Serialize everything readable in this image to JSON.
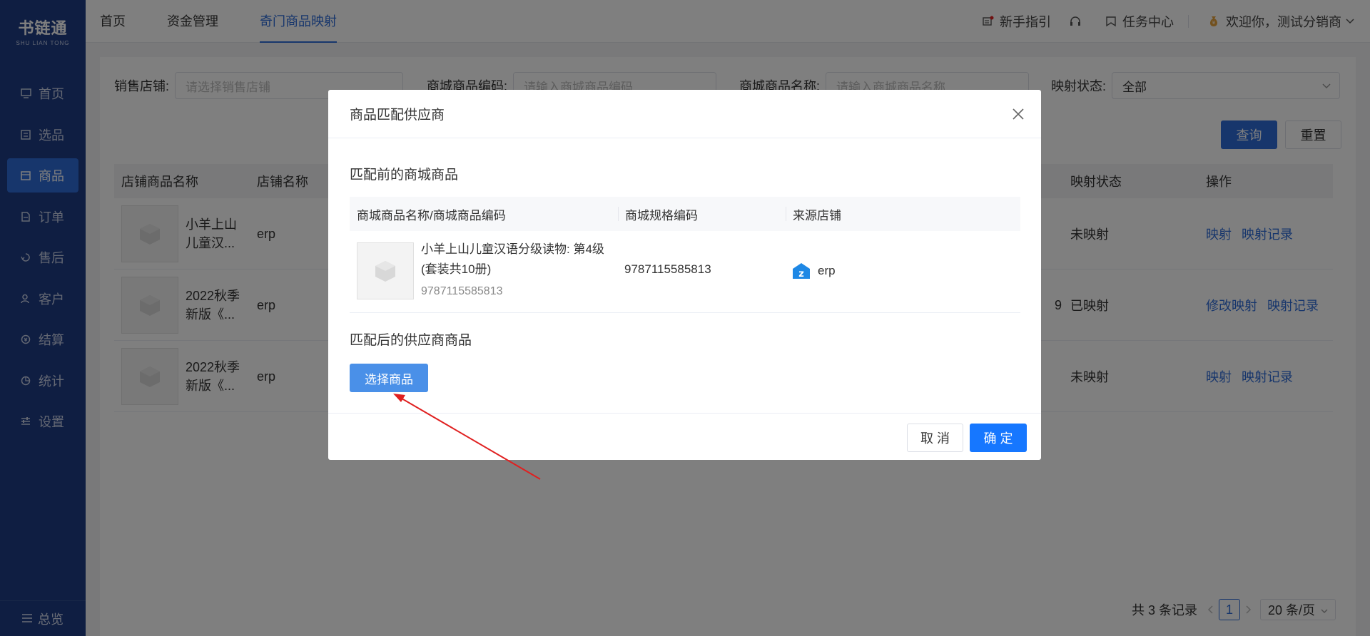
{
  "app": {
    "logo_cn": "书链通",
    "logo_en": "SHU LIAN TONG"
  },
  "sidebar": {
    "items": [
      {
        "label": "首页",
        "icon": "monitor-icon"
      },
      {
        "label": "选品",
        "icon": "select-icon"
      },
      {
        "label": "商品",
        "icon": "product-icon",
        "active": true
      },
      {
        "label": "订单",
        "icon": "order-icon"
      },
      {
        "label": "售后",
        "icon": "aftersale-icon"
      },
      {
        "label": "客户",
        "icon": "customer-icon"
      },
      {
        "label": "结算",
        "icon": "settlement-icon"
      },
      {
        "label": "统计",
        "icon": "chart-icon"
      },
      {
        "label": "设置",
        "icon": "settings-icon"
      }
    ],
    "bottom_label": "总览"
  },
  "topnav": {
    "tabs": [
      "首页",
      "资金管理",
      "奇门商品映射"
    ],
    "active_index": 2
  },
  "topright": {
    "guide": "新手指引",
    "tasks": "任务中心",
    "welcome": "欢迎你，测试分销商"
  },
  "filters": {
    "store_label": "销售店铺:",
    "store_placeholder": "请选择销售店铺",
    "code_label": "商城商品编码:",
    "code_placeholder": "请输入商城商品编码",
    "name_label": "商城商品名称:",
    "name_placeholder": "请输入商城商品名称",
    "status_label": "映射状态:",
    "status_value": "全部",
    "query": "查询",
    "reset": "重置"
  },
  "table": {
    "headers": [
      "店铺商品名称",
      "店铺名称",
      "映射状态",
      "操作"
    ],
    "rows": [
      {
        "name": "小羊上山儿童汉...",
        "shop": "erp",
        "extra": "",
        "status": "未映射",
        "actions": [
          "映射",
          "映射记录"
        ]
      },
      {
        "name": "2022秋季新版《...",
        "shop": "erp",
        "extra": "9",
        "status": "已映射",
        "actions": [
          "修改映射",
          "映射记录"
        ]
      },
      {
        "name": "2022秋季新版《...",
        "shop": "erp",
        "extra": "",
        "status": "未映射",
        "actions": [
          "映射",
          "映射记录"
        ]
      }
    ]
  },
  "pager": {
    "total": "共 3 条记录",
    "page": "1",
    "size": "20 条/页"
  },
  "modal": {
    "title": "商品匹配供应商",
    "before_title": "匹配前的商城商品",
    "columns": [
      "商城商品名称/商城商品编码",
      "商城规格编码",
      "来源店铺"
    ],
    "item": {
      "name": "小羊上山儿童汉语分级读物: 第4级(套装共10册)",
      "code": "9787115585813",
      "spec": "9787115585813",
      "shop": "erp"
    },
    "after_title": "匹配后的供应商商品",
    "select_button": "选择商品",
    "cancel": "取 消",
    "ok": "确 定"
  },
  "colors": {
    "sidebar": "#1e3c84",
    "primary": "#2f6cd9",
    "annotation_arrow": "#e02020"
  }
}
